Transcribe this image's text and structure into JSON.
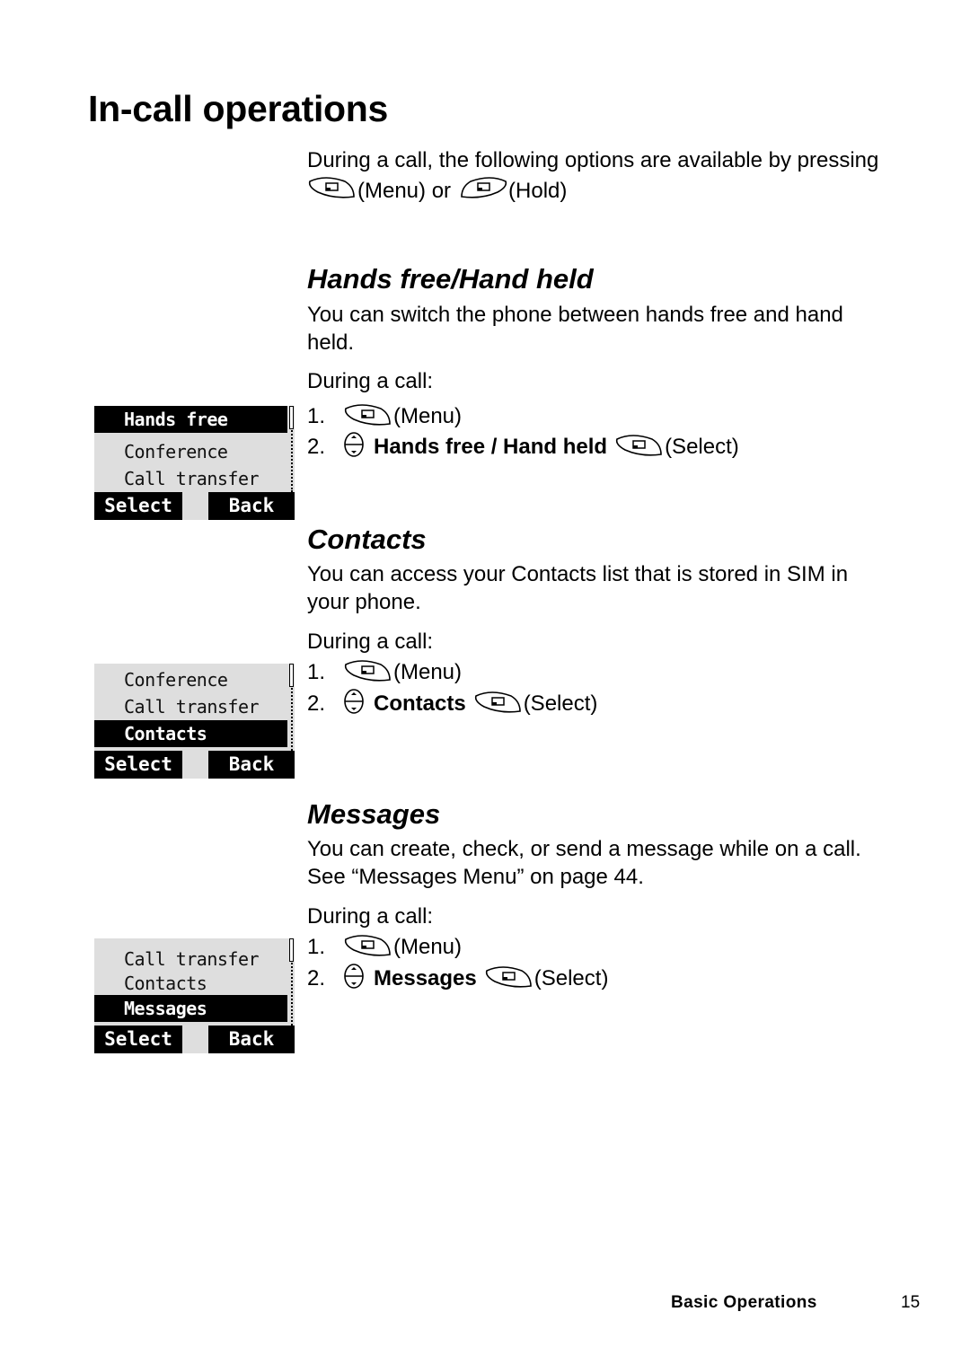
{
  "page": {
    "title": "In-call operations",
    "intro": {
      "text": "During a call, the following options are available by pressing",
      "menu_label": "(Menu) or",
      "hold_label": "(Hold)"
    },
    "icons": {
      "soft_key": "soft-key-icon",
      "nav_key": "navigation-key-icon"
    },
    "sections": [
      {
        "heading": "Hands free/Hand held",
        "description_lines": [
          "You can switch the phone between hands free and hand",
          "held."
        ],
        "during": "During a call:",
        "steps": [
          {
            "num": "1.",
            "label": "(Menu)"
          },
          {
            "num": "2.",
            "bold": "Hands free / Hand held",
            "label": "(Select)"
          }
        ],
        "screen": {
          "rows": [
            "Hands free",
            "Conference",
            "Call transfer"
          ],
          "selected": 0,
          "soft_left": "Select",
          "soft_right": "Back"
        }
      },
      {
        "heading": "Contacts",
        "description_lines": [
          "You can access your Contacts list that is stored in SIM in",
          "your phone."
        ],
        "during": "During a call:",
        "steps": [
          {
            "num": "1.",
            "label": "(Menu)"
          },
          {
            "num": "2.",
            "bold": "Contacts",
            "label": "(Select)"
          }
        ],
        "screen": {
          "rows": [
            "Conference",
            "Call transfer",
            "Contacts"
          ],
          "selected": 2,
          "soft_left": "Select",
          "soft_right": "Back"
        }
      },
      {
        "heading": "Messages",
        "description_lines": [
          "You can create, check, or send a message while on a call.",
          "See “Messages Menu” on page 44."
        ],
        "during": "During a call:",
        "steps": [
          {
            "num": "1.",
            "label": "(Menu)"
          },
          {
            "num": "2.",
            "bold": "Messages",
            "label": "(Select)"
          }
        ],
        "screen": {
          "rows": [
            "Call transfer",
            "Contacts",
            "Messages"
          ],
          "selected": 2,
          "soft_left": "Select",
          "soft_right": "Back"
        }
      }
    ],
    "footer": {
      "section": "Basic Operations",
      "page_number": "15"
    }
  }
}
